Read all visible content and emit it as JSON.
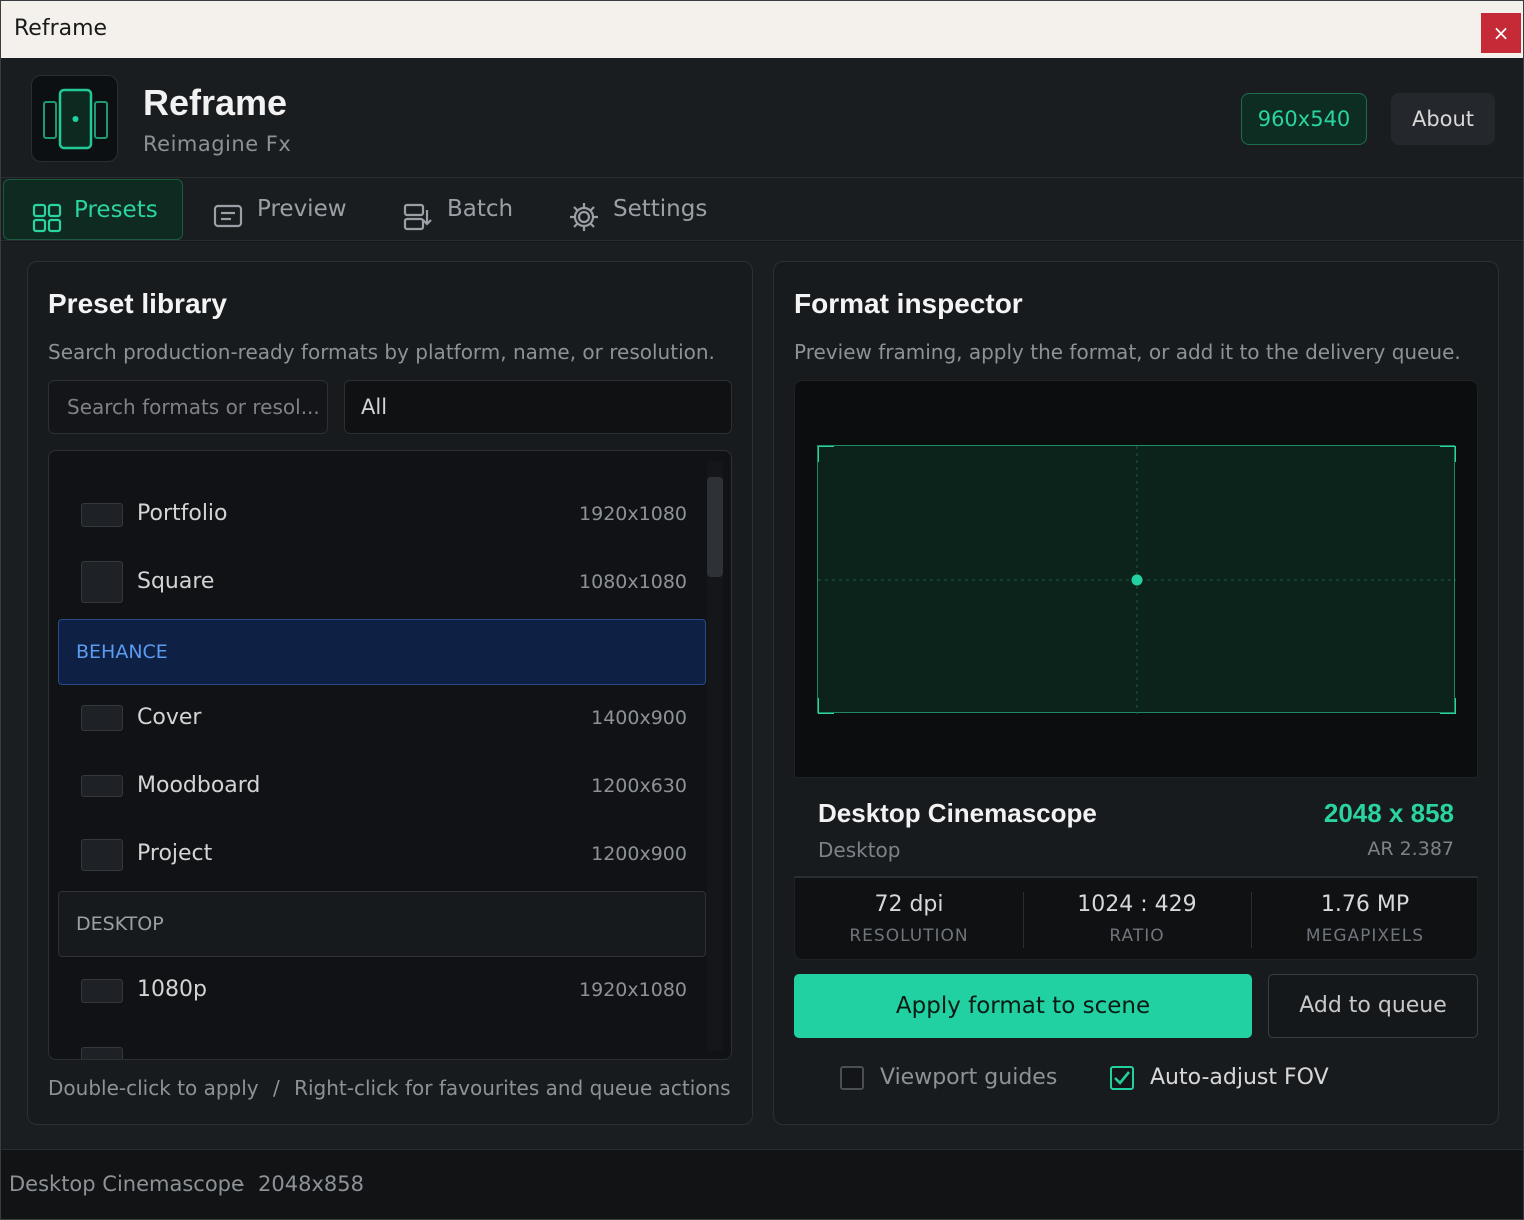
{
  "window": {
    "title": "Reframe",
    "close_glyph": "×"
  },
  "header": {
    "app_name": "Reframe",
    "app_subtitle": "Reimagine Fx",
    "resolution_badge": "960x540",
    "about_label": "About",
    "logo_icon": "reframe-logo-icon"
  },
  "tabs": [
    {
      "label": "Presets",
      "icon": "grid-icon",
      "active": true
    },
    {
      "label": "Preview",
      "icon": "preview-icon",
      "active": false
    },
    {
      "label": "Batch",
      "icon": "batch-icon",
      "active": false
    },
    {
      "label": "Settings",
      "icon": "gear-icon",
      "active": false
    }
  ],
  "library": {
    "title": "Preset library",
    "subtitle": "Search production-ready formats by platform, name, or resolution.",
    "search_placeholder": "Search formats or resol...",
    "filter_value": "All",
    "items": [
      {
        "name": "Portfolio",
        "res": "1920x1080"
      },
      {
        "name": "Square",
        "res": "1080x1080"
      },
      {
        "group": "BEHANCE",
        "selected": true
      },
      {
        "name": "Cover",
        "res": "1400x900"
      },
      {
        "name": "Moodboard",
        "res": "1200x630"
      },
      {
        "name": "Project",
        "res": "1200x900"
      },
      {
        "group": "DESKTOP",
        "selected": false
      },
      {
        "name": "1080p",
        "res": "1920x1080"
      }
    ],
    "hint_a": "Double-click to apply",
    "hint_sep": "/",
    "hint_b": "Right-click for favourites and queue actions"
  },
  "inspector": {
    "title": "Format inspector",
    "subtitle": "Preview framing, apply the format, or add it to the delivery queue.",
    "format_name": "Desktop Cinemascope",
    "category": "Desktop",
    "dimensions": "2048 x 858",
    "aspect_ratio": "AR 2.387",
    "stats": [
      {
        "value": "72 dpi",
        "label": "RESOLUTION"
      },
      {
        "value": "1024 : 429",
        "label": "RATIO"
      },
      {
        "value": "1.76 MP",
        "label": "MEGAPIXELS"
      }
    ],
    "apply_label": "Apply format to scene",
    "queue_label": "Add to queue",
    "viewport_guides_label": "Viewport guides",
    "viewport_guides_checked": false,
    "auto_fov_label": "Auto-adjust FOV",
    "auto_fov_checked": true
  },
  "status": {
    "name": "Desktop Cinemascope",
    "sep": "-",
    "res": "2048x858"
  },
  "colors": {
    "accent": "#22d1a1",
    "selection": "#5b9bf0",
    "close": "#c42b36"
  }
}
